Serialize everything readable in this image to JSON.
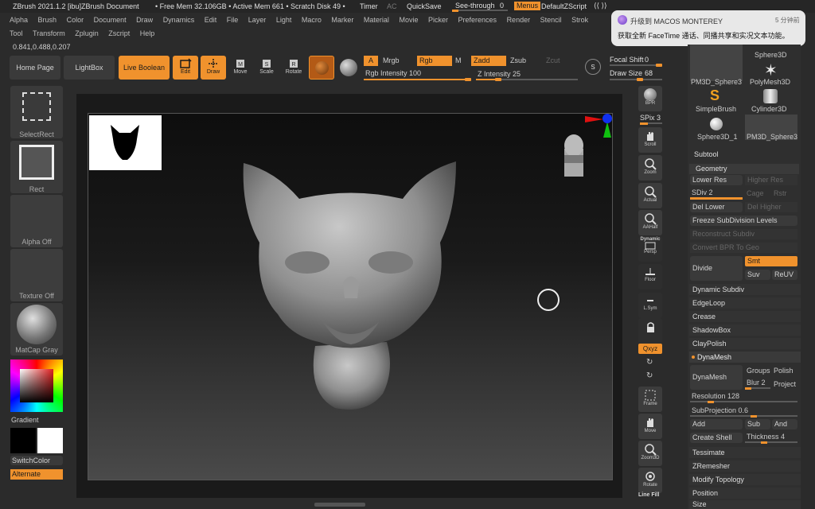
{
  "titlebar": {
    "app_title": "ZBrush 2021.1.2 [ibu]ZBrush Document",
    "mem_info": "• Free Mem 32.106GB • Active Mem 661 • Scratch Disk 49 •",
    "timer": "Timer",
    "ac": "AC",
    "quicksave": "QuickSave",
    "seethrough_label": "See-through",
    "seethrough_value": "0",
    "menus": "Menus",
    "default_zscript": "DefaultZScript"
  },
  "menubar": {
    "row1": [
      "Alpha",
      "Brush",
      "Color",
      "Document",
      "Draw",
      "Dynamics",
      "Edit",
      "File",
      "Layer",
      "Light",
      "Macro",
      "Marker",
      "Material",
      "Movie",
      "Picker",
      "Preferences",
      "Render",
      "Stencil",
      "Strok"
    ],
    "row2": [
      "Tool",
      "Transform",
      "Zplugin",
      "Zscript",
      "Help"
    ]
  },
  "coords": "0.841,0.488,0.207",
  "notification": {
    "title": "升级到 MACOS MONTEREY",
    "time": "5 分钟前",
    "body": "获取全新 FaceTime 通话、同播共享和实况文本功能。"
  },
  "toolbar": {
    "home_page": "Home Page",
    "lightbox": "LightBox",
    "live_boolean": "Live Boolean",
    "edit": "Edit",
    "draw": "Draw",
    "move": "Move",
    "scale": "Scale",
    "rotate": "Rotate",
    "a": "A",
    "mrgb": "Mrgb",
    "rgb": "Rgb",
    "m": "M",
    "zadd": "Zadd",
    "zsub": "Zsub",
    "zcut": "Zcut",
    "rgb_intensity": "Rgb Intensity 100",
    "z_intensity": "Z Intensity 25",
    "focal_shift": "Focal Shift",
    "focal_shift_value": "0",
    "draw_size": "Draw Size",
    "draw_size_value": "68",
    "rgb_intensity_level": 1.0,
    "z_intensity_level": 0.25
  },
  "left_shelf": {
    "selectrect": "SelectRect",
    "rect": "Rect",
    "alpha_off": "Alpha Off",
    "texture_off": "Texture Off",
    "matcap_gray": "MatCap Gray",
    "gradient": "Gradient",
    "switchcolor": "SwitchColor",
    "alternate": "Alternate"
  },
  "right_shelf": {
    "bpr": "BPR",
    "spix": "SPix 3",
    "scroll": "Scroll",
    "zoom": "Zoom",
    "actual": "Actual",
    "aahalf": "AAHalf",
    "dynamic": "Dynamic",
    "persp": "Persp",
    "floor": "Floor",
    "lsym": "L.Sym",
    "xyz": "Qxyz",
    "frame": "Frame",
    "move": "Move",
    "zoom3d": "Zoom3D",
    "rotate": "Rotate",
    "linefill": "Line Fill"
  },
  "tool_palette": {
    "items": [
      "PM3D_Sphere3",
      "PolyMesh3D",
      "Sphere3D",
      "SimpleBrush",
      "Cylinder3D",
      "Sphere3D_1",
      "PM3D_Sphere3"
    ],
    "subtool": "Subtool",
    "geometry": "Geometry",
    "lower_res": "Lower Res",
    "higher_res": "Higher Res",
    "sdiv": "SDiv 2",
    "cage": "Cage",
    "rstr": "Rstr",
    "del_lower": "Del Lower",
    "del_higher": "Del Higher",
    "freeze_subdiv": "Freeze SubDivision Levels",
    "reconstruct_subdiv": "Reconstruct Subdiv",
    "convert_bpr": "Convert BPR To Geo",
    "divide": "Divide",
    "smt": "Smt",
    "suv": "Suv",
    "reuv": "ReUV",
    "dynamic_subdiv": "Dynamic Subdiv",
    "edgeloop": "EdgeLoop",
    "crease": "Crease",
    "shadowbox": "ShadowBox",
    "claypolish": "ClayPolish",
    "dynamesh_header": "DynaMesh",
    "dynamesh": "DynaMesh",
    "groups": "Groups",
    "polish": "Polish",
    "blur": "Blur 2",
    "project": "Project",
    "resolution": "Resolution 128",
    "subprojection": "SubProjection 0.6",
    "add": "Add",
    "sub": "Sub",
    "and": "And",
    "create_shell": "Create Shell",
    "thickness": "Thickness 4",
    "tessimate": "Tessimate",
    "zremesher": "ZRemesher",
    "modify_topology": "Modify Topology",
    "position": "Position",
    "size": "Size"
  },
  "colors": {
    "accent": "#f0922d",
    "bg": "#2b2b2b",
    "panel": "#333333"
  }
}
